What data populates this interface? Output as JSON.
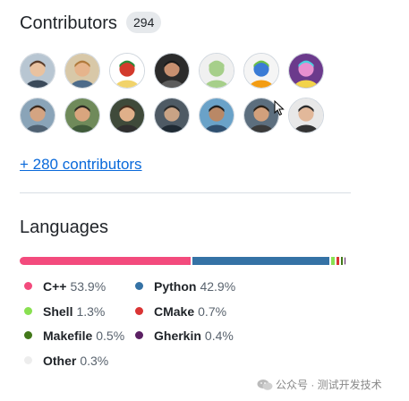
{
  "contributors": {
    "title": "Contributors",
    "count": "294",
    "more_link": "+ 280 contributors",
    "avatars": [
      {
        "bg": "#b8c6d2",
        "skin": "#e9c2a0",
        "hair": "#5a3d2b",
        "shirt": "#3b4a5a"
      },
      {
        "bg": "#d8c8a8",
        "skin": "#e6b48c",
        "hair": "#b07a3c",
        "shirt": "#4d6b8a"
      },
      {
        "bg": "#ffffff",
        "skin": "#d33a2c",
        "hair": "#2c8a3a",
        "shirt": "#f1d36b"
      },
      {
        "bg": "#2b2b2b",
        "skin": "#c89070",
        "hair": "#1b1b1b",
        "shirt": "#5c5c5c"
      },
      {
        "bg": "#f0f0f0",
        "skin": "#a6cf8a",
        "hair": "#a6cf8a",
        "shirt": "#a6cf8a"
      },
      {
        "bg": "#f5f5f5",
        "skin": "#3a7bd5",
        "hair": "#6cc04a",
        "shirt": "#f39c12"
      },
      {
        "bg": "#6b3a8c",
        "skin": "#e88fd0",
        "hair": "#4bd0e0",
        "shirt": "#f2d34a"
      },
      {
        "bg": "#8aa4b8",
        "skin": "#d4a482",
        "hair": "#3b2a1e",
        "shirt": "#4f6172"
      },
      {
        "bg": "#6f8a5a",
        "skin": "#d9a57e",
        "hair": "#2e2a22",
        "shirt": "#3f5a3a"
      },
      {
        "bg": "#3f4a3a",
        "skin": "#e0b08a",
        "hair": "#4a3020",
        "shirt": "#2f2f2f"
      },
      {
        "bg": "#4e5a64",
        "skin": "#c9a385",
        "hair": "#2a2a2a",
        "shirt": "#1f2a33"
      },
      {
        "bg": "#6aa2c8",
        "skin": "#b98866",
        "hair": "#1f1f1f",
        "shirt": "#2f4f6f"
      },
      {
        "bg": "#5c6e7e",
        "skin": "#d2a07c",
        "hair": "#2b2118",
        "shirt": "#3a3a3a"
      },
      {
        "bg": "#e8e8e8",
        "skin": "#e2b89a",
        "hair": "#2a2a2a",
        "shirt": "#333333"
      }
    ]
  },
  "languages": {
    "title": "Languages",
    "items": [
      {
        "name": "C++",
        "percent": "53.9%",
        "value": 53.9,
        "color": "#f34b7d"
      },
      {
        "name": "Python",
        "percent": "42.9%",
        "value": 42.9,
        "color": "#3572A5"
      },
      {
        "name": "Shell",
        "percent": "1.3%",
        "value": 1.3,
        "color": "#89e051"
      },
      {
        "name": "CMake",
        "percent": "0.7%",
        "value": 0.7,
        "color": "#DA3434"
      },
      {
        "name": "Makefile",
        "percent": "0.5%",
        "value": 0.5,
        "color": "#427819"
      },
      {
        "name": "Gherkin",
        "percent": "0.4%",
        "value": 0.4,
        "color": "#5B2063"
      },
      {
        "name": "Other",
        "percent": "0.3%",
        "value": 0.3,
        "color": "#ededed"
      }
    ]
  },
  "watermark": {
    "text": "公众号 · 测试开发技术"
  }
}
